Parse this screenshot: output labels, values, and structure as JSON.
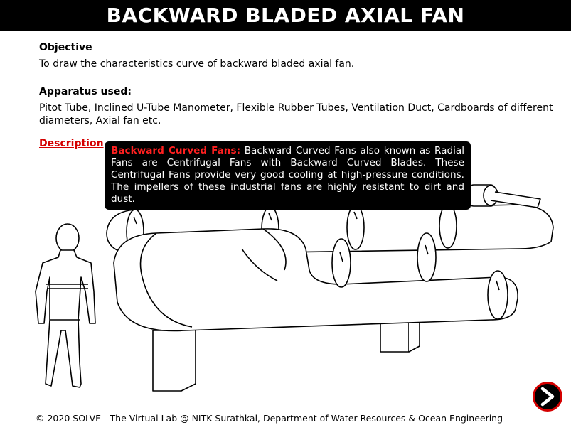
{
  "title": "BACKWARD BLADED AXIAL FAN",
  "objective": {
    "heading": "Objective",
    "text": "To draw the characteristics curve of backward bladed axial fan."
  },
  "apparatus": {
    "heading": "Apparatus used:",
    "text": "Pitot Tube, Inclined U-Tube Manometer, Flexible Rubber Tubes, Ventilation Duct, Cardboards of different diameters, Axial fan etc."
  },
  "description": {
    "link_label": "Description",
    "tooltip_title": "Backward Curved Fans:",
    "tooltip_text": "Backward Curved Fans also known as Radial Fans are Centrifugal Fans with Backward Curved Blades. These Centrifugal Fans provide very good cooling at high-pressure conditions. The impellers of these industrial fans are highly resistant to dirt and dust."
  },
  "navigation": {
    "next_icon": "next-arrow-icon"
  },
  "footer": {
    "text": "© 2020 SOLVE - The Virtual Lab @ NITK Surathkal, Department of Water Resources & Ocean Engineering"
  },
  "colors": {
    "title_bg": "#000000",
    "accent_red": "#d40000",
    "tooltip_bg": "#000000"
  }
}
